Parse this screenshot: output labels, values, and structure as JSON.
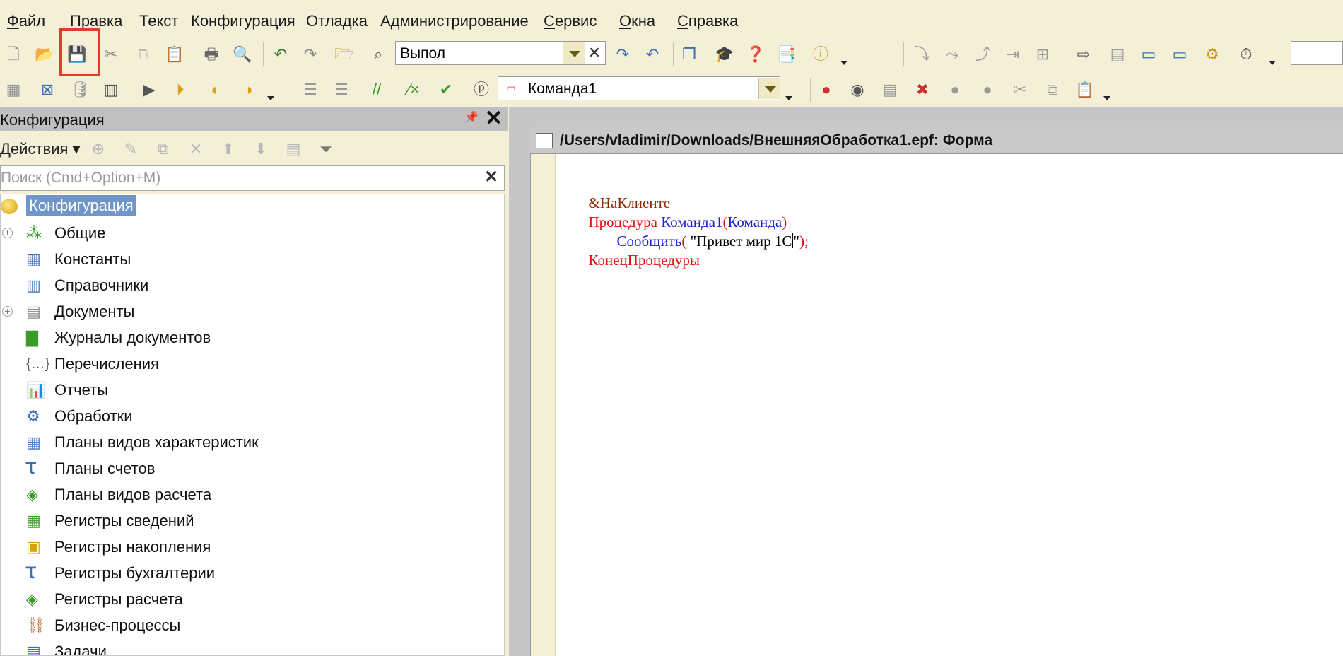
{
  "menu": [
    {
      "label": "Файл",
      "underline": "Ф",
      "rest": "айл"
    },
    {
      "label": "Правка",
      "underline": "П",
      "rest": "равка"
    },
    {
      "label": "Текст"
    },
    {
      "label": "Конфигурация"
    },
    {
      "label": "Отладка"
    },
    {
      "label": "Администрирование"
    },
    {
      "label": "Сервис",
      "underline": "С",
      "rest": "ервис"
    },
    {
      "label": "Окна",
      "underline": "О",
      "rest": "кна"
    },
    {
      "label": "Справка",
      "underline": "С",
      "rest": "правка"
    }
  ],
  "toolbar": {
    "search_combo_value": "Выпол",
    "method_combo_value": "Команда1"
  },
  "panel": {
    "title": "Конфигурация",
    "actions_label": "Действия",
    "search_placeholder": "Поиск (Cmd+Option+M)"
  },
  "tree": {
    "root": "Конфигурация",
    "items": [
      {
        "label": "Общие",
        "expandable": true
      },
      {
        "label": "Константы"
      },
      {
        "label": "Справочники"
      },
      {
        "label": "Документы",
        "expandable": true
      },
      {
        "label": "Журналы документов"
      },
      {
        "label": "Перечисления"
      },
      {
        "label": "Отчеты"
      },
      {
        "label": "Обработки"
      },
      {
        "label": "Планы видов характеристик"
      },
      {
        "label": "Планы счетов"
      },
      {
        "label": "Планы видов расчета"
      },
      {
        "label": "Регистры сведений"
      },
      {
        "label": "Регистры накопления"
      },
      {
        "label": "Регистры бухгалтерии"
      },
      {
        "label": "Регистры расчета"
      },
      {
        "label": "Бизнес-процессы"
      },
      {
        "label": "Задачи"
      }
    ]
  },
  "editor": {
    "title": "/Users/vladimir/Downloads/ВнешняяОбработка1.epf: Форма",
    "code": {
      "directive": "&НаКлиенте",
      "proc_kw": "Процедура",
      "proc_name": "Команда1",
      "paren_open": "(",
      "param": "Команда",
      "paren_close": ")",
      "call_name": "Сообщить",
      "call_open": "(",
      "string_a": "\"Привет мир 1С",
      "string_b": "\"",
      "call_close": ");",
      "end_kw": "КонецПроцедуры"
    }
  },
  "colors": {
    "background": "#f4f0d8",
    "highlight": "#e03e2a",
    "selection": "#6f95c9",
    "code_keyword": "#e01010",
    "code_identifier": "#1f1fd6",
    "code_directive": "#8b2a00"
  }
}
